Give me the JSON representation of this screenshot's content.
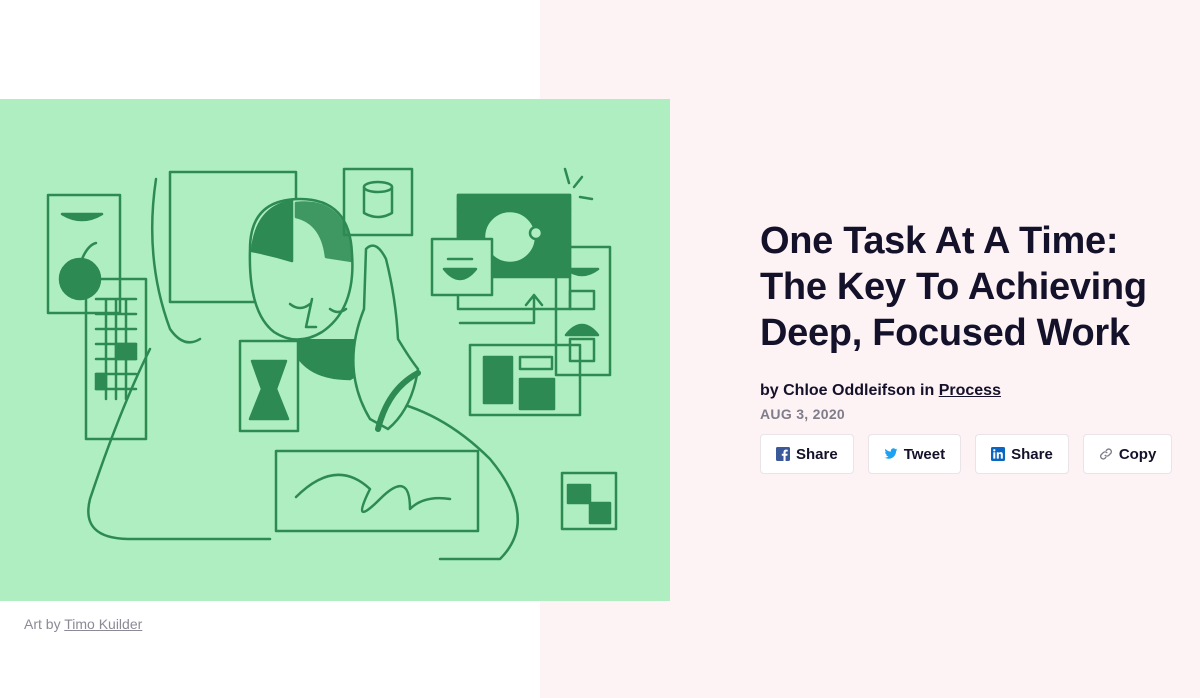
{
  "caption": {
    "prefix": "Art by",
    "artist": "Timo Kuilder"
  },
  "article": {
    "title": "One Task At A Time: The Key To Achieving Deep, Focused Work",
    "byline_prefix": "by",
    "author": "Chloe Oddleifson",
    "in_label": "in",
    "category": "Process",
    "date": "AUG 3, 2020"
  },
  "share": [
    {
      "label": "Share",
      "icon": "facebook-icon"
    },
    {
      "label": "Tweet",
      "icon": "twitter-icon"
    },
    {
      "label": "Share",
      "icon": "linkedin-icon"
    },
    {
      "label": "Copy",
      "icon": "link-icon"
    }
  ],
  "colors": {
    "hero_bg": "#aeeec0",
    "illustration_ink": "#2c8a52",
    "panel_bg": "#fdf2f4",
    "title": "#14112a",
    "date": "#7f7d8a",
    "facebook": "#3b5998",
    "twitter": "#1da1f2",
    "linkedin": "#0a66c2"
  }
}
